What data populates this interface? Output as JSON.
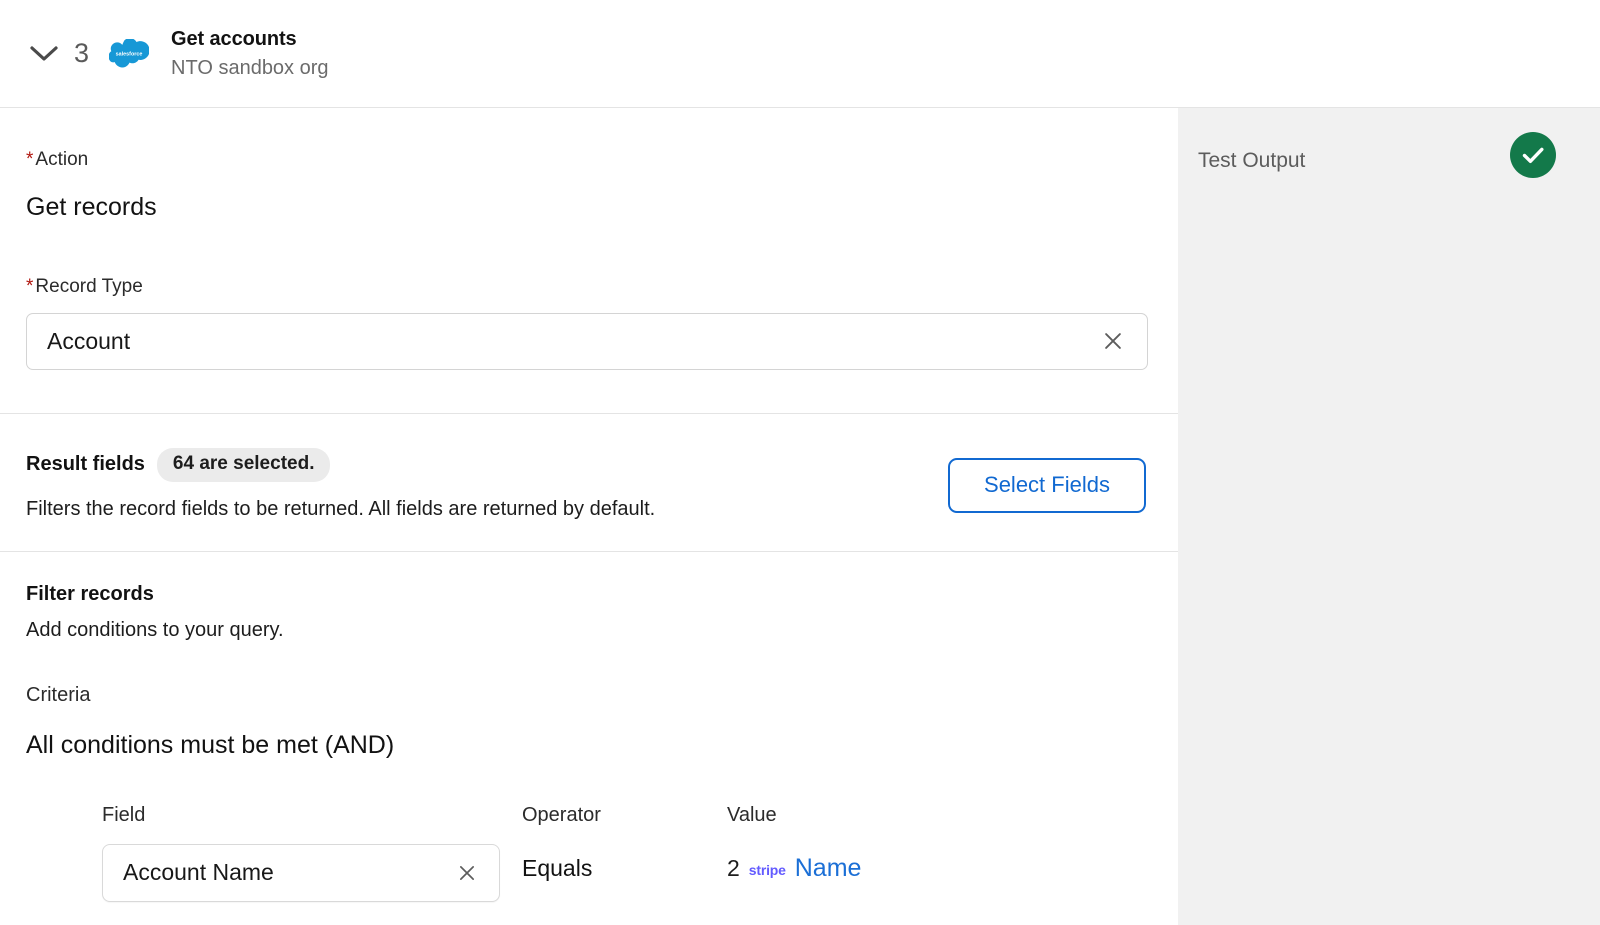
{
  "header": {
    "expand_icon": "chevron-down-icon",
    "step_number": "3",
    "app_icon": "salesforce-cloud-icon",
    "title": "Get accounts",
    "subtitle": "NTO sandbox org"
  },
  "action_section": {
    "label": "Action",
    "required_marker": "*",
    "value": "Get records"
  },
  "record_type_section": {
    "label": "Record Type",
    "required_marker": "*",
    "value": "Account",
    "clear_icon": "close-icon"
  },
  "result_fields_section": {
    "heading": "Result fields",
    "badge": "64 are selected.",
    "description": "Filters the record fields to be returned. All fields are returned by default.",
    "button_label": "Select Fields"
  },
  "filter_section": {
    "heading": "Filter records",
    "description": "Add conditions to your query.",
    "criteria_label": "Criteria",
    "criteria_value": "All conditions must be met (AND)",
    "columns": {
      "field": "Field",
      "operator": "Operator",
      "value": "Value"
    },
    "condition": {
      "field_value": "Account Name",
      "field_clear_icon": "close-icon",
      "operator_value": "Equals",
      "value_step_index": "2",
      "value_brand": "stripe",
      "value_token": "Name"
    }
  },
  "test_output_panel": {
    "title": "Test Output",
    "status_icon": "check-circle-icon",
    "status": "success"
  },
  "colors": {
    "accent_blue": "#1169d1",
    "link_blue": "#1b6fd6",
    "stripe_purple": "#635bff",
    "required_red": "#b0160f",
    "success_green": "#13794a",
    "panel_gray": "#f1f1f1",
    "badge_gray": "#ebebeb",
    "salesforce_blue": "#00a1e0"
  }
}
